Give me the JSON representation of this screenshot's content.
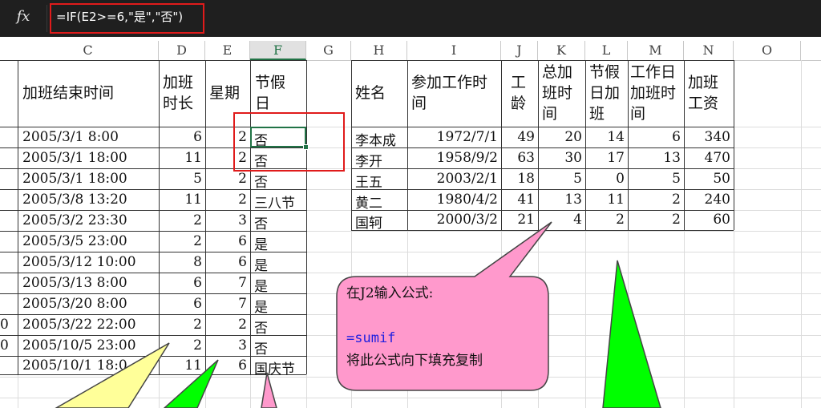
{
  "formula_bar": {
    "fx_label": "fx",
    "formula": "=IF(E2>=6,\"是\",\"否\")"
  },
  "columns": [
    "C",
    "D",
    "E",
    "F",
    "G",
    "H",
    "I",
    "J",
    "K",
    "L",
    "M",
    "N",
    "O"
  ],
  "left_table": {
    "headers": {
      "c": "加班结束时间",
      "d1": "加班",
      "d2": "时长",
      "e": "星期",
      "f1": "节假",
      "f2": "日"
    },
    "rows": [
      {
        "a": "",
        "c": "2005/3/1  8:00",
        "d": "6",
        "e": "2",
        "f": "否"
      },
      {
        "a": "",
        "c": "2005/3/1  18:00",
        "d": "11",
        "e": "2",
        "f": "否"
      },
      {
        "a": "",
        "c": "2005/3/1  18:00",
        "d": "5",
        "e": "2",
        "f": "否"
      },
      {
        "a": "",
        "c": "2005/3/8  13:20",
        "d": "11",
        "e": "2",
        "f": "三八节"
      },
      {
        "a": "",
        "c": "2005/3/2  23:30",
        "d": "2",
        "e": "3",
        "f": "否"
      },
      {
        "a": "",
        "c": "2005/3/5  23:00",
        "d": "2",
        "e": "6",
        "f": "是"
      },
      {
        "a": "",
        "c": "2005/3/12  10:00",
        "d": "8",
        "e": "6",
        "f": "是"
      },
      {
        "a": "",
        "c": "2005/3/13  8:00",
        "d": "6",
        "e": "7",
        "f": "是"
      },
      {
        "a": "",
        "c": "2005/3/20  8:00",
        "d": "6",
        "e": "7",
        "f": "是"
      },
      {
        "a": "0",
        "c": "2005/3/22  22:00",
        "d": "2",
        "e": "2",
        "f": "否"
      },
      {
        "a": "0",
        "c": "2005/10/5  23:00",
        "d": "2",
        "e": "3",
        "f": "否"
      },
      {
        "a": "",
        "c": "2005/10/1  18:0",
        "d": "11",
        "e": "6",
        "f": "国庆节"
      }
    ]
  },
  "right_table": {
    "headers": {
      "h": "姓名",
      "i1": "参加工作时",
      "i2": "间",
      "j1": "工",
      "j2": "龄",
      "k1": "总加",
      "k2": "班时",
      "k3": "间",
      "l1": "节假",
      "l2": "日加",
      "l3": "班",
      "m1": "工作日",
      "m2": "加班时",
      "m3": "间",
      "n1": "加班",
      "n2": "工资"
    },
    "rows": [
      {
        "name": "李本成",
        "date": "1972/7/1",
        "age": "49",
        "total": "20",
        "holiday": "14",
        "workday": "6",
        "pay": "340"
      },
      {
        "name": "李开",
        "date": "1958/9/2",
        "age": "63",
        "total": "30",
        "holiday": "17",
        "workday": "13",
        "pay": "470"
      },
      {
        "name": "王五",
        "date": "2003/2/1",
        "age": "18",
        "total": "5",
        "holiday": "0",
        "workday": "5",
        "pay": "50"
      },
      {
        "name": "黄二",
        "date": "1980/4/2",
        "age": "41",
        "total": "13",
        "holiday": "11",
        "workday": "2",
        "pay": "240"
      },
      {
        "name": "国轲",
        "date": "2000/3/2",
        "age": "21",
        "total": "4",
        "holiday": "2",
        "workday": "2",
        "pay": "60"
      }
    ]
  },
  "callout": {
    "line1": "在J2输入公式:",
    "line2": "=sumif",
    "line3": "将此公式向下填充复制"
  },
  "colors": {
    "callout_fill": "#ff99cc",
    "green_shape": "#00ff00",
    "yellow_shape": "#ffff99",
    "accent": "#217346",
    "highlight": "#e01b1b"
  }
}
